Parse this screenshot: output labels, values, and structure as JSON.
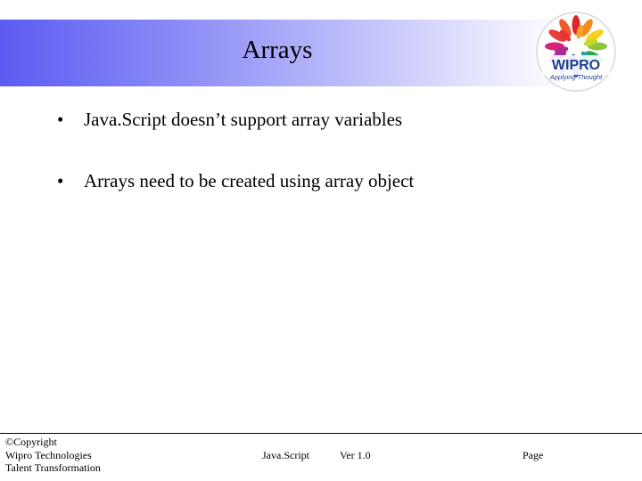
{
  "slide": {
    "title": "Arrays",
    "bullets": [
      "Java.Script doesn’t support array variables",
      "Arrays need to be created using array object"
    ]
  },
  "logo": {
    "text": "WIPRO",
    "tagline": "Applying Thought"
  },
  "footer": {
    "copyright": "©Copyright",
    "company": "Wipro Technologies",
    "department": "Talent Transformation",
    "topic": "Java.Script",
    "version": "Ver 1.0",
    "page_label": "Page"
  },
  "colors": {
    "title_gradient_start": "#5b5bf2",
    "logo_red": "#e0262b",
    "logo_blue": "#1f3f8f"
  }
}
